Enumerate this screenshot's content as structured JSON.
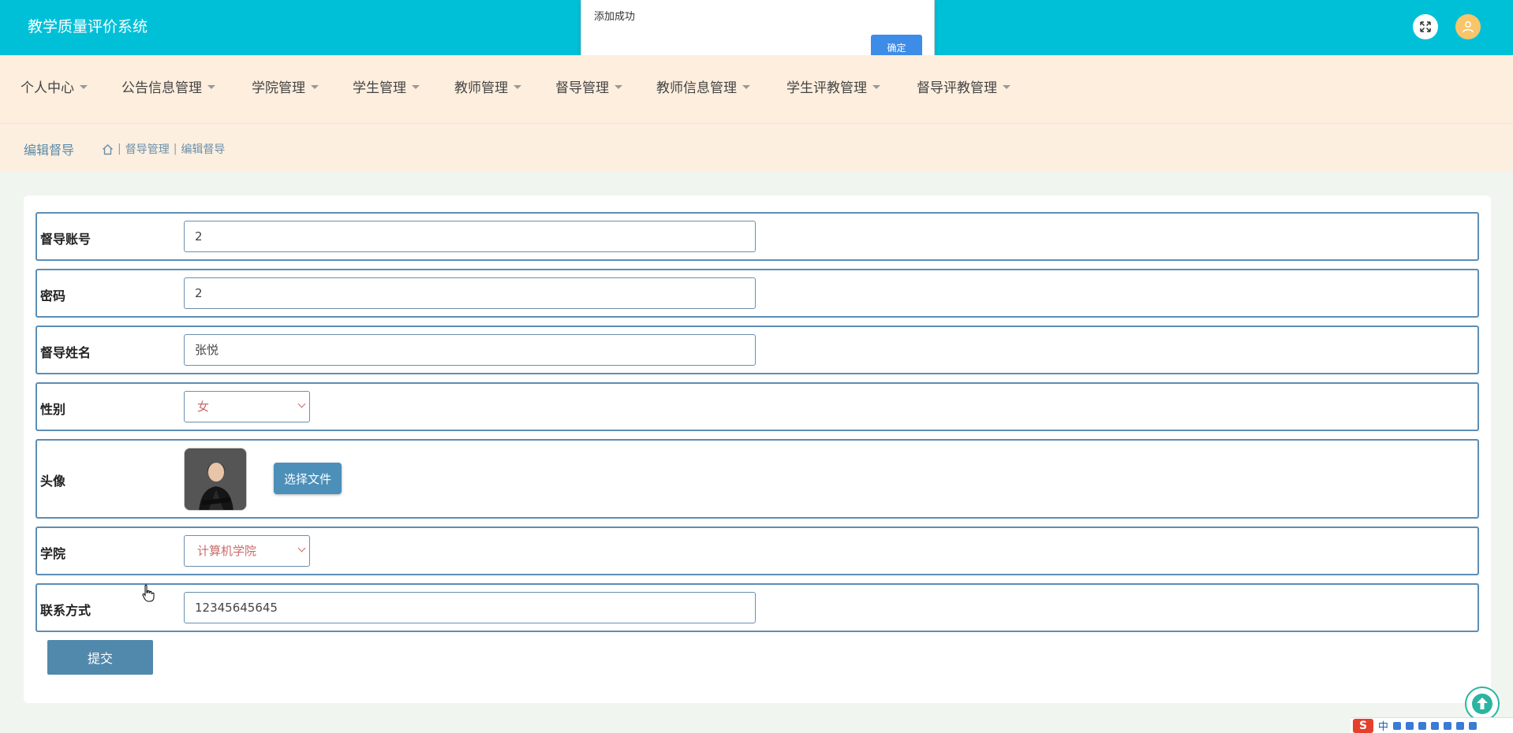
{
  "header": {
    "app_title": "教学质量评价系统",
    "fullscreen_icon": "expand-icon",
    "user_icon": "user-icon"
  },
  "alert": {
    "message": "添加成功",
    "ok_label": "确定"
  },
  "nav": {
    "items": [
      {
        "label": "个人中心"
      },
      {
        "label": "公告信息管理"
      },
      {
        "label": "学院管理"
      },
      {
        "label": "学生管理"
      },
      {
        "label": "教师管理"
      },
      {
        "label": "督导管理"
      },
      {
        "label": "教师信息管理"
      },
      {
        "label": "学生评教管理"
      },
      {
        "label": "督导评教管理"
      }
    ]
  },
  "breadcrumb": {
    "page_title": "编辑督导",
    "home_icon": "home-icon",
    "level1": "督导管理",
    "level2": "编辑督导"
  },
  "form": {
    "account": {
      "label": "督导账号",
      "value": "2"
    },
    "password": {
      "label": "密码",
      "value": "2"
    },
    "name": {
      "label": "督导姓名",
      "value": "张悦"
    },
    "gender": {
      "label": "性别",
      "value": "女"
    },
    "avatar": {
      "label": "头像",
      "button": "选择文件"
    },
    "college": {
      "label": "学院",
      "value": "计算机学院"
    },
    "phone": {
      "label": "联系方式",
      "value": "12345645645"
    },
    "submit_label": "提交"
  },
  "colors": {
    "topbar": "#00c0d8",
    "navbar": "#fdeede",
    "accent_button": "#5189ad",
    "alert_button": "#3d8ce8"
  },
  "taskbar": {
    "ime_logo": "S",
    "ime_mode": "中"
  }
}
